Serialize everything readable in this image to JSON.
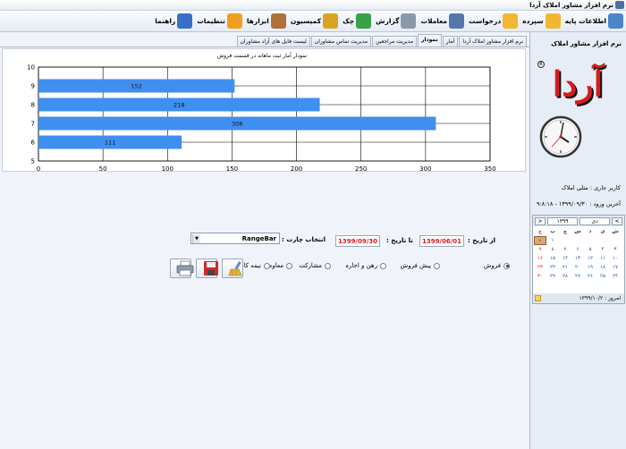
{
  "window": {
    "title": "نرم افزار مشاور املاک آردا"
  },
  "toolbar": {
    "items": [
      {
        "label": "اطلاعات پایه",
        "icon": "base-info-icon",
        "color": "#4a86c8"
      },
      {
        "label": "سپرده",
        "icon": "deposit-folder-icon",
        "color": "#f2b632"
      },
      {
        "label": "درخواست",
        "icon": "request-folder-icon",
        "color": "#f2b632"
      },
      {
        "label": "معاملات",
        "icon": "deals-edit-icon",
        "color": "#5577aa"
      },
      {
        "label": "گزارش",
        "icon": "report-search-icon",
        "color": "#8a99aa"
      },
      {
        "label": "چک",
        "icon": "check-icon",
        "color": "#3aa04a"
      },
      {
        "label": "کمیسیون",
        "icon": "commission-icon",
        "color": "#d9a520"
      },
      {
        "label": "ابزارها",
        "icon": "tools-icon",
        "color": "#b0703a"
      },
      {
        "label": "تنظیمات",
        "icon": "settings-gear-icon",
        "color": "#f0a020"
      },
      {
        "label": "راهنما",
        "icon": "help-icon",
        "color": "#3a6fc8"
      }
    ]
  },
  "tabs": [
    {
      "label": "نرم افزار مشاور املاک آردا",
      "active": false
    },
    {
      "label": "آمار",
      "active": false
    },
    {
      "label": "نمودار",
      "active": true
    },
    {
      "label": "مدیریت مراجعین",
      "active": false
    },
    {
      "label": "مدیریت تماس مشاوران",
      "active": false
    },
    {
      "label": "لیست فایل های آزاد مشاوران",
      "active": false
    }
  ],
  "chart_data": {
    "type": "bar",
    "orientation": "horizontal",
    "title": "نمودار آمار ثبت ماهانه در قسمت فروش",
    "categories": [
      "9",
      "8",
      "7",
      "6"
    ],
    "values": [
      152,
      218,
      308,
      111
    ],
    "xlim": [
      0,
      350
    ],
    "ylim": [
      5,
      10
    ],
    "x_ticks": [
      "0",
      "50",
      "100",
      "150",
      "200",
      "250",
      "300",
      "350"
    ],
    "y_ticks": [
      "10",
      "9",
      "8",
      "7",
      "6",
      "5"
    ],
    "bar_color": "#3f8ff0",
    "grid": true
  },
  "sidebar": {
    "title": "نرم افزار مشاور املاک",
    "logo_text": "آردا",
    "reg_mark": "R",
    "current_user": "کاربر جاری : مثلی املاک",
    "last_login": "آخرین ورود : ۱۳۹۹/۰۹/۳۰ - ۹:۸:۱۸",
    "calendar": {
      "prev": ">",
      "next": "<",
      "month": "دی",
      "year": "۱۳۹۹",
      "weekdays": [
        "ش",
        "ی",
        "د",
        "س",
        "چ",
        "پ",
        "ج"
      ],
      "days": [
        "",
        "",
        "",
        "",
        "",
        "۱",
        "۲",
        "۳",
        "۴",
        "۵",
        "۶",
        "۷",
        "۸",
        "۹",
        "۱۰",
        "۱۱",
        "۱۲",
        "۱۳",
        "۱۴",
        "۱۵",
        "۱۶",
        "۱۷",
        "۱۸",
        "۱۹",
        "۲۰",
        "۲۱",
        "۲۲",
        "۲۳",
        "۲۴",
        "۲۵",
        "۲۶",
        "۲۷",
        "۲۸",
        "۲۹",
        "۳۰",
        "",
        "",
        "",
        "",
        "",
        "",
        ""
      ],
      "today_label": "امروز : ۱۳۹۹/۱۰/۲"
    }
  },
  "controls": {
    "from_date_label": "از تاریخ :",
    "from_date_value": "1399/06/01",
    "to_date_label": "تا تاریخ :",
    "to_date_value": "1399/09/30",
    "chart_type_label": "انتخاب چارت :",
    "chart_type_value": "RangeBar",
    "radios": [
      {
        "label": "فروش",
        "checked": true
      },
      {
        "label": "پیش فروش",
        "checked": false
      },
      {
        "label": "رهن و اجاره",
        "checked": false
      },
      {
        "label": "مشارکت",
        "checked": false
      },
      {
        "label": "معاوضه",
        "checked": false
      },
      {
        "label": "نیمه کاره",
        "checked": false
      }
    ]
  }
}
